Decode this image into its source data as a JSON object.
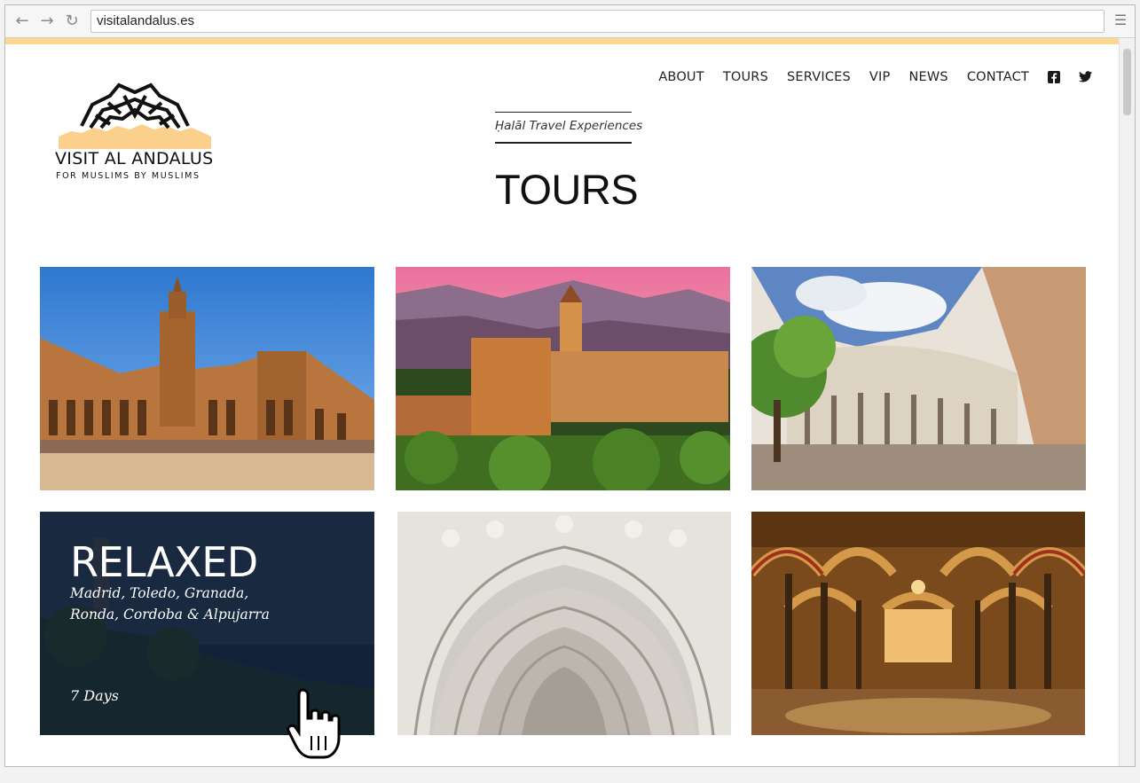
{
  "browser": {
    "url": "visitalandalus.es",
    "back_icon": "back-arrow-icon",
    "forward_icon": "forward-arrow-icon",
    "reload_icon": "reload-icon",
    "menu_icon": "hamburger-menu-icon"
  },
  "brand": {
    "name": "VISIT AL ANDALUS",
    "tagline": "FOR MUSLIMS BY MUSLIMS",
    "accent_color": "#fcd790"
  },
  "nav": {
    "items": [
      "ABOUT",
      "TOURS",
      "SERVICES",
      "VIP",
      "NEWS",
      "CONTACT"
    ],
    "social": [
      "facebook-icon",
      "twitter-icon"
    ]
  },
  "header": {
    "tagline": "Ḥalāl Travel Experiences",
    "title": "TOURS"
  },
  "tours": {
    "featured": {
      "name": "RELAXED",
      "places": "Madrid, Toledo, Granada, Ronda, Cordoba & Alpujarra",
      "duration": "7 Days"
    },
    "photos": [
      "Plaza de España, Seville",
      "Alhambra, Granada",
      "Plaza de Toros arcade",
      "Carved white arch",
      "Mezquita of Córdoba"
    ]
  }
}
